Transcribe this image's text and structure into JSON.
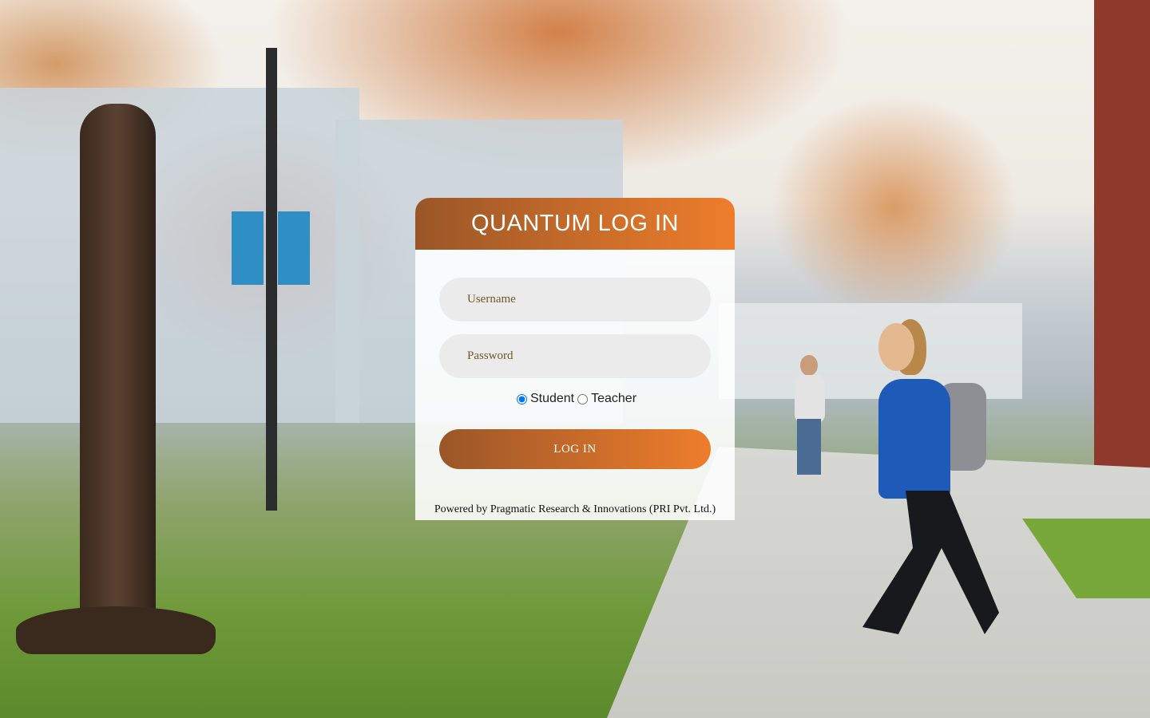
{
  "login": {
    "title": "QUANTUM LOG IN",
    "username_placeholder": "Username",
    "password_placeholder": "Password",
    "roles": [
      {
        "label": "Student",
        "checked": true
      },
      {
        "label": "Teacher",
        "checked": false
      }
    ],
    "login_button": "LOG IN",
    "powered_by": "Powered by Pragmatic Research & Innovations (PRI Pvt. Ltd.)"
  },
  "colors": {
    "header_gradient_start": "#9a5628",
    "header_gradient_end": "#ee7d2b",
    "field_background": "#ebebeb",
    "card_background": "rgba(255,255,255,0.88)"
  }
}
